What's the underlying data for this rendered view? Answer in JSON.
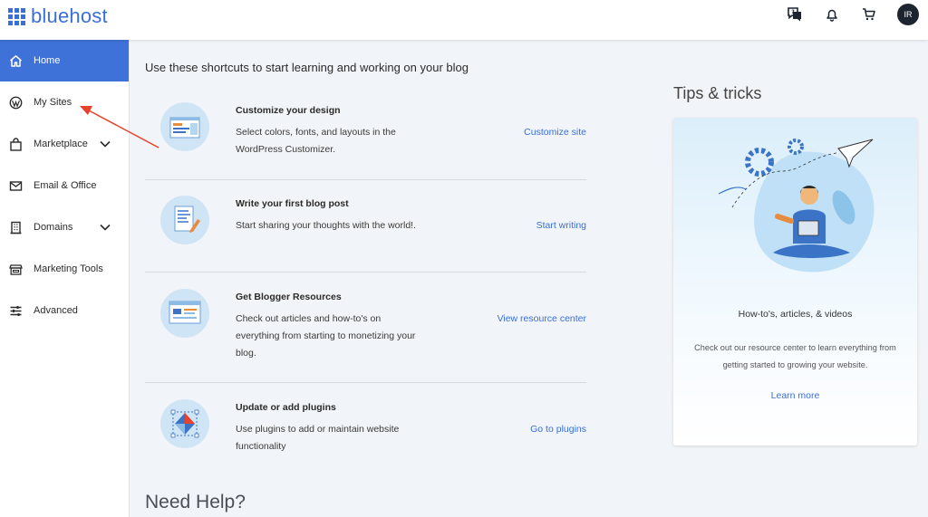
{
  "brand": {
    "name": "bluehost",
    "color": "#3a6fd8"
  },
  "header": {
    "icons": [
      "help-chat-icon",
      "bell-icon",
      "cart-icon"
    ],
    "avatar_initials": "IR"
  },
  "sidebar": {
    "items": [
      {
        "label": "Home",
        "icon": "home-icon",
        "active": true,
        "expandable": false
      },
      {
        "label": "My Sites",
        "icon": "wordpress-icon",
        "active": false,
        "expandable": false
      },
      {
        "label": "Marketplace",
        "icon": "bag-icon",
        "active": false,
        "expandable": true
      },
      {
        "label": "Email & Office",
        "icon": "mail-icon",
        "active": false,
        "expandable": false
      },
      {
        "label": "Domains",
        "icon": "building-icon",
        "active": false,
        "expandable": true
      },
      {
        "label": "Marketing Tools",
        "icon": "storefront-icon",
        "active": false,
        "expandable": false
      },
      {
        "label": "Advanced",
        "icon": "sliders-icon",
        "active": false,
        "expandable": false
      }
    ]
  },
  "main": {
    "title": "Use these shortcuts to start learning and working on your blog",
    "shortcuts": [
      {
        "title": "Customize your design",
        "description": "Select colors, fonts, and layouts in the WordPress Customizer.",
        "link": "Customize site",
        "icon": "customize-illustration-icon"
      },
      {
        "title": "Write your first blog post",
        "description": "Start sharing your thoughts with the world!.",
        "link": "Start writing",
        "icon": "document-pencil-icon"
      },
      {
        "title": "Get Blogger Resources",
        "description": "Check out articles and how-to's on everything from starting to monetizing your blog.",
        "link": "View resource center",
        "icon": "browser-window-icon"
      },
      {
        "title": "Update or add plugins",
        "description": "Use plugins to add or maintain website functionality",
        "link": "Go to plugins",
        "icon": "plugin-diamond-icon"
      }
    ],
    "need_help": "Need Help?"
  },
  "tips": {
    "title": "Tips & tricks",
    "card_title": "How-to's, articles, & videos",
    "card_description": "Check out our resource center to learn everything from getting started to growing your website.",
    "link": "Learn more"
  },
  "colors": {
    "accent": "#3f72d9",
    "link": "#3a6fd8",
    "annotation_arrow": "#e8412c",
    "page_bg": "#f1f4f8"
  }
}
